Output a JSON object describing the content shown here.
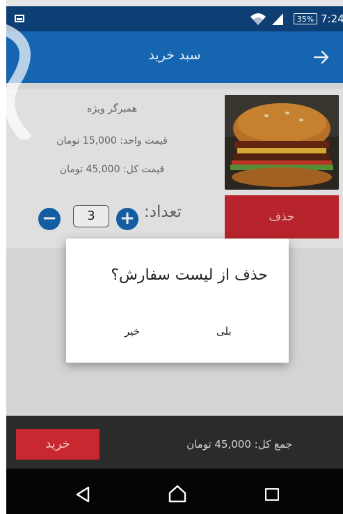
{
  "status_bar": {
    "battery": "35%",
    "time": "7:24"
  },
  "app_bar": {
    "title": "سبد خرید"
  },
  "cart_item": {
    "name": "همبرگر ویژه",
    "unit_price": "قیمت واحد: 15,000 تومان",
    "total_price": "قیمت کل: 45,000 تومان",
    "quantity_label": "تعداد:",
    "quantity": "3",
    "plus": "+",
    "minus": "−",
    "delete_label": "حذف"
  },
  "dialog": {
    "message": "حذف از لیست سفارش؟",
    "yes_label": "بلی",
    "no_label": "خیر"
  },
  "bottom_bar": {
    "total": "جمع کل: 45,000 تومان",
    "buy_label": "خرید"
  },
  "colors": {
    "primary": "#1565b0",
    "status_bar": "#0d3f74",
    "danger": "#c8282f",
    "bottom_bar": "#2b2b2b"
  },
  "icons": [
    "image-icon",
    "wifi-icon",
    "signal-icon",
    "battery-icon",
    "back-arrow-icon",
    "nav-back-icon",
    "nav-home-icon",
    "nav-recent-icon"
  ]
}
